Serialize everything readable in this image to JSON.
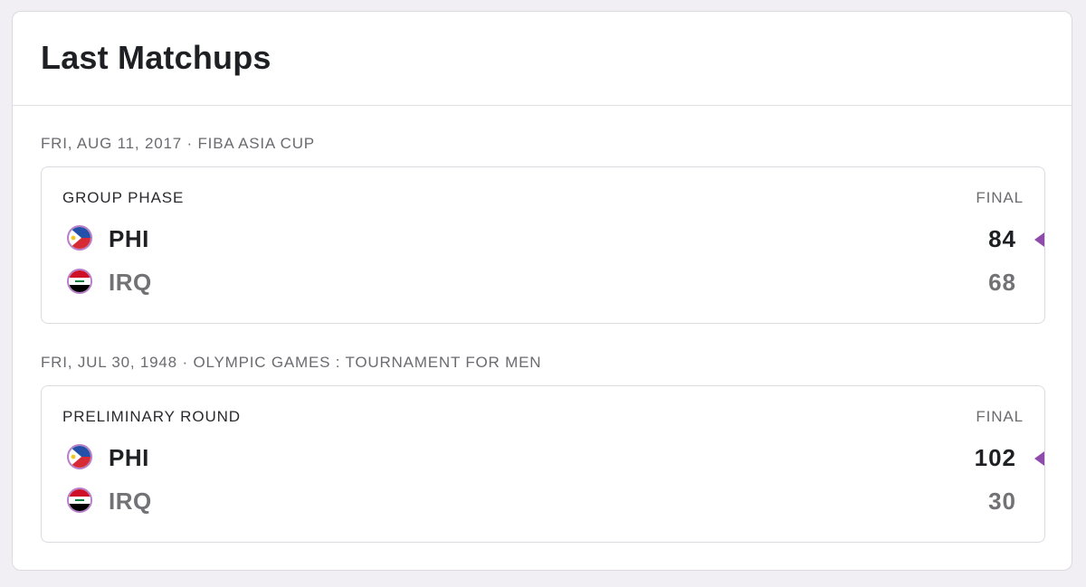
{
  "title": "Last Matchups",
  "matchups": [
    {
      "date": "FRI, AUG 11, 2017",
      "competition": "FIBA ASIA CUP",
      "round": "GROUP PHASE",
      "status": "FINAL",
      "teams": [
        {
          "abbr": "PHI",
          "score": "84",
          "winner": true,
          "logo_icon": "philippines-flag-icon"
        },
        {
          "abbr": "IRQ",
          "score": "68",
          "winner": false,
          "logo_icon": "iraq-flag-icon"
        }
      ]
    },
    {
      "date": "FRI, JUL 30, 1948",
      "competition": "OLYMPIC GAMES : TOURNAMENT FOR MEN",
      "round": "PRELIMINARY ROUND",
      "status": "FINAL",
      "teams": [
        {
          "abbr": "PHI",
          "score": "102",
          "winner": true,
          "logo_icon": "philippines-flag-icon"
        },
        {
          "abbr": "IRQ",
          "score": "30",
          "winner": false,
          "logo_icon": "iraq-flag-icon"
        }
      ]
    }
  ],
  "colors": {
    "accent": "#8e4bab",
    "logo_ring": "#b77fc7",
    "text_primary": "#1f2024",
    "text_muted": "#717176"
  }
}
